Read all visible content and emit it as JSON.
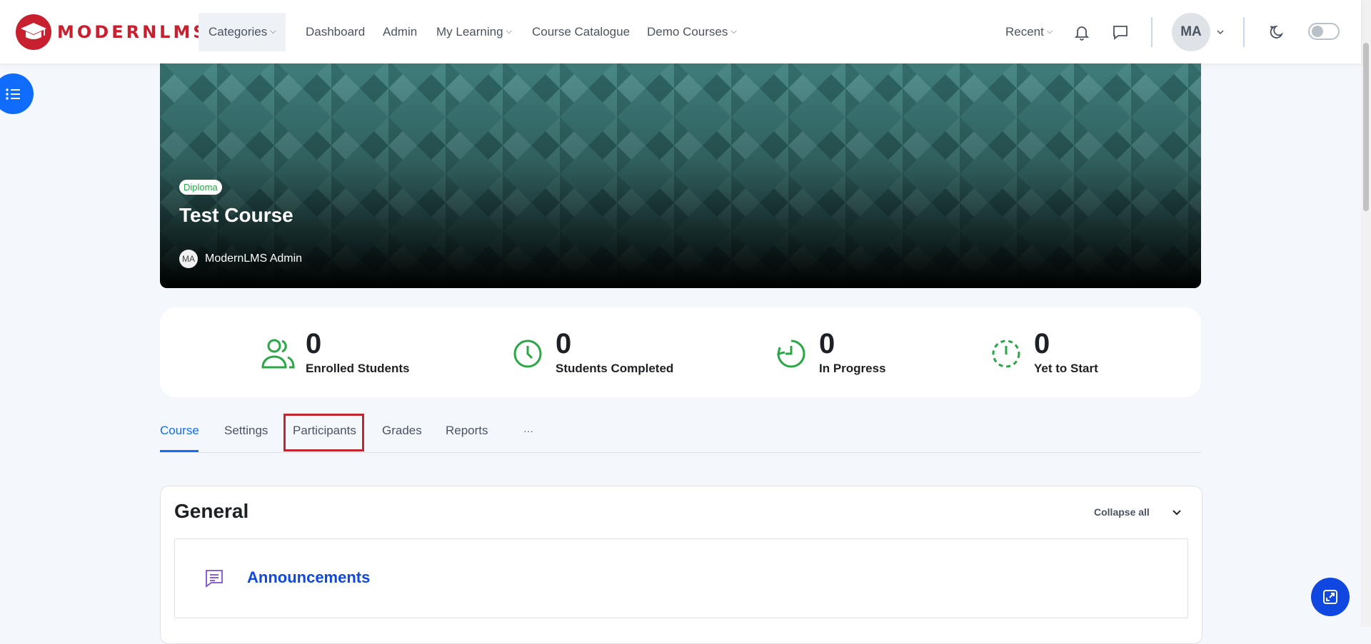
{
  "brand": {
    "logo_text": "MODERNLMS",
    "accent": "#c8202f"
  },
  "nav": {
    "categories": "Categories",
    "dashboard": "Dashboard",
    "admin": "Admin",
    "my_learning": "My Learning",
    "course_catalogue": "Course Catalogue",
    "demo_courses": "Demo Courses",
    "recent": "Recent"
  },
  "user": {
    "initials": "MA"
  },
  "course": {
    "badge": "Diploma",
    "title": "Test Course",
    "teacher_initials": "MA",
    "teacher_name": "ModernLMS Admin"
  },
  "stats": [
    {
      "value": "0",
      "label": "Enrolled Students",
      "icon": "users-icon"
    },
    {
      "value": "0",
      "label": "Students Completed",
      "icon": "clock-icon"
    },
    {
      "value": "0",
      "label": "In Progress",
      "icon": "progress-clock-icon"
    },
    {
      "value": "0",
      "label": "Yet to Start",
      "icon": "dashed-clock-icon"
    }
  ],
  "tabs": [
    {
      "label": "Course",
      "active": true
    },
    {
      "label": "Settings"
    },
    {
      "label": "Participants"
    },
    {
      "label": "Grades"
    },
    {
      "label": "Reports"
    },
    {
      "label": "···"
    }
  ],
  "section": {
    "title": "General",
    "collapse_label": "Collapse all",
    "activity": {
      "name": "Announcements",
      "icon": "forum-icon"
    }
  },
  "colors": {
    "primary": "#0f6cfd",
    "success": "#28a745",
    "highlight": "#c1272d"
  }
}
